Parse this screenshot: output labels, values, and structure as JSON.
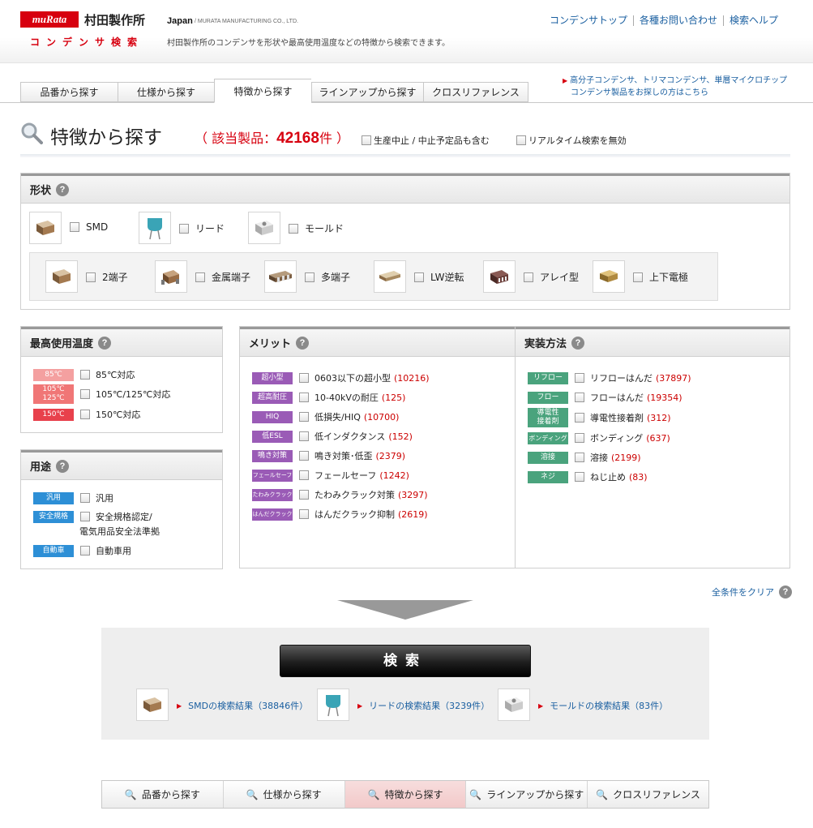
{
  "header": {
    "logo": "muRata",
    "company": "村田製作所",
    "subtitle": "コンデンサ検索",
    "region": "Japan",
    "region_sub": "/ MURATA MANUFACTURING CO., LTD.",
    "description": "村田製作所のコンデンサを形状や最高使用温度などの特徴から検索できます。",
    "links": [
      "コンデンサトップ",
      "各種お問い合わせ",
      "検索ヘルプ"
    ]
  },
  "tabs": [
    "品番から探す",
    "仕様から探す",
    "特徴から探す",
    "ラインアップから探す",
    "クロスリファレンス"
  ],
  "notice": [
    "高分子コンデンサ、トリマコンデンサ、単層マイクロチップ",
    "コンデンサ製品をお探しの方はこちら"
  ],
  "title": {
    "text": "特徴から探す",
    "count_prefix": "（ 該当製品：",
    "count": "42168",
    "count_suffix": "件 ）",
    "option1": "生産中止 / 中止予定品も含む",
    "option2": "リアルタイム検索を無効"
  },
  "shape": {
    "heading": "形状",
    "main": [
      "SMD",
      "リード",
      "モールド"
    ],
    "sub": [
      "2端子",
      "金属端子",
      "多端子",
      "LW逆転",
      "アレイ型",
      "上下電極"
    ]
  },
  "temp": {
    "heading": "最高使用温度",
    "items": [
      {
        "badge": "85℃",
        "label": "85℃対応",
        "color": "#f4a0a0"
      },
      {
        "badge": "105℃\n125℃",
        "label": "105℃/125℃対応",
        "color": "#f07676"
      },
      {
        "badge": "150℃",
        "label": "150℃対応",
        "color": "#e8414c"
      }
    ]
  },
  "use": {
    "heading": "用途",
    "items": [
      {
        "badge": "汎用",
        "label": "汎用",
        "label2": ""
      },
      {
        "badge": "安全規格",
        "label": "安全規格認定/",
        "label2": "電気用品安全法準拠"
      },
      {
        "badge": "自動車",
        "label": "自動車用",
        "label2": ""
      }
    ]
  },
  "merit": {
    "heading": "メリット",
    "items": [
      {
        "badge": "超小型",
        "label": "0603以下の超小型",
        "count": "(10216)"
      },
      {
        "badge": "超高耐圧",
        "label": "10-40kVの耐圧",
        "count": "(125)"
      },
      {
        "badge": "HIQ",
        "label": "低損失/HIQ",
        "count": "(10700)"
      },
      {
        "badge": "低ESL",
        "label": "低インダクタンス",
        "count": "(152)"
      },
      {
        "badge": "鳴き対策",
        "label": "鳴き対策･低歪",
        "count": "(2379)"
      },
      {
        "badge": "フェールセーフ",
        "label": "フェールセーフ",
        "count": "(1242)"
      },
      {
        "badge": "たわみクラック",
        "label": "たわみクラック対策",
        "count": "(3297)"
      },
      {
        "badge": "はんだクラック",
        "label": "はんだクラック抑制",
        "count": "(2619)"
      }
    ]
  },
  "mount": {
    "heading": "実装方法",
    "items": [
      {
        "badge": "リフロー",
        "label": "リフローはんだ",
        "count": "(37897)"
      },
      {
        "badge": "フロー",
        "label": "フローはんだ",
        "count": "(19354)"
      },
      {
        "badge": "導電性\n接着剤",
        "label": "導電性接着剤",
        "count": "(312)"
      },
      {
        "badge": "ボンディング",
        "label": "ボンディング",
        "count": "(637)"
      },
      {
        "badge": "溶接",
        "label": "溶接",
        "count": "(2199)"
      },
      {
        "badge": "ネジ",
        "label": "ねじ止め",
        "count": "(83)"
      }
    ]
  },
  "clear_label": "全条件をクリア",
  "search": {
    "button": "検索",
    "results": [
      "SMDの検索結果（38846件）",
      "リードの検索結果（3239件）",
      "モールドの検索結果（83件）"
    ]
  },
  "bottom_nav": [
    "品番から探す",
    "仕様から探す",
    "特徴から探す",
    "ラインアップから探す",
    "クロスリファレンス"
  ],
  "colors": {
    "brand": "#d7000f",
    "link": "#1a5fa0",
    "merit_badge": "#9a5bb6",
    "mount_badge": "#4aa37d",
    "use_badge": "#2d8fd6"
  }
}
